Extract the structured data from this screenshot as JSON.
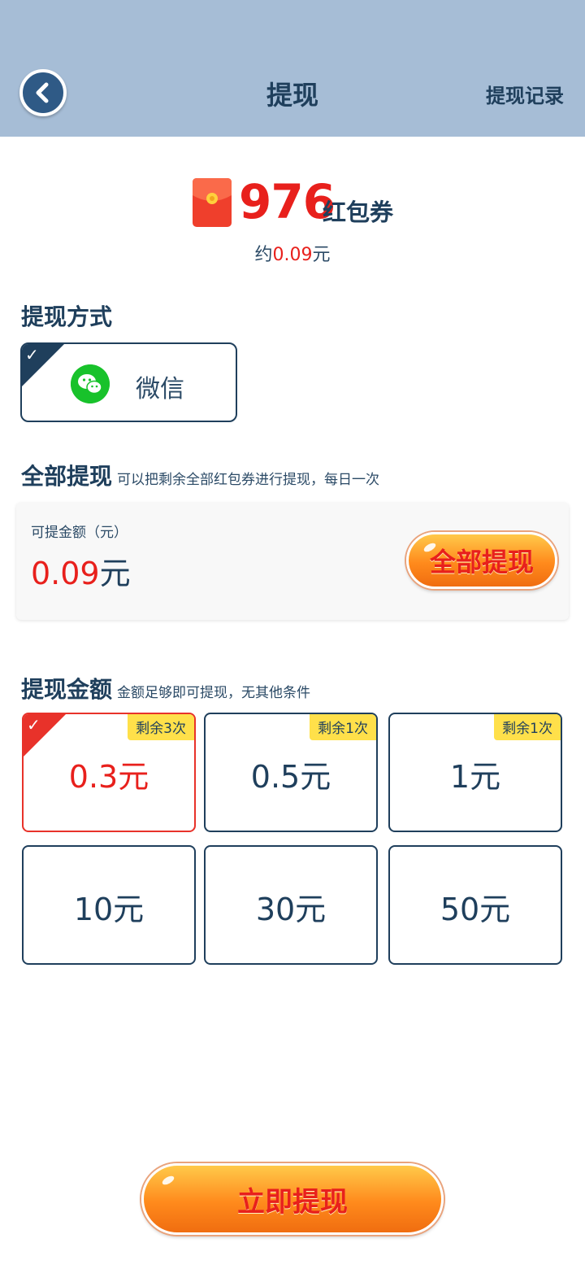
{
  "header": {
    "title": "提现",
    "history_label": "提现记录",
    "color": "#a6bdd6"
  },
  "balance": {
    "amount": "976",
    "unit": "红包券",
    "approx_prefix": "约",
    "approx_value": "0.09",
    "approx_suffix": "元"
  },
  "method_section": {
    "title": "提现方式",
    "methods": [
      {
        "label": "微信",
        "icon": "wechat-icon",
        "selected": true
      }
    ]
  },
  "all_section": {
    "title": "全部提现",
    "subtitle": "可以把剩余全部红包券进行提现，每日一次",
    "caption": "可提金额（元）",
    "amount": "0.09",
    "amount_unit": "元",
    "button_label": "全部提现"
  },
  "amount_section": {
    "title": "提现金额",
    "subtitle": "金额足够即可提现，无其他条件",
    "options": [
      {
        "value": "0.3元",
        "badge": "剩余3次",
        "selected": true
      },
      {
        "value": "0.5元",
        "badge": "剩余1次",
        "selected": false
      },
      {
        "value": "1元",
        "badge": "剩余1次",
        "selected": false
      },
      {
        "value": "10元",
        "badge": "",
        "selected": false
      },
      {
        "value": "30元",
        "badge": "",
        "selected": false
      },
      {
        "value": "50元",
        "badge": "",
        "selected": false
      }
    ]
  },
  "submit": {
    "label": "立即提现"
  },
  "colors": {
    "accent_red": "#e8201c",
    "dark_blue": "#1f3f5c",
    "badge_yellow": "#ffe04a",
    "button_orange": "#ff8a1c"
  }
}
